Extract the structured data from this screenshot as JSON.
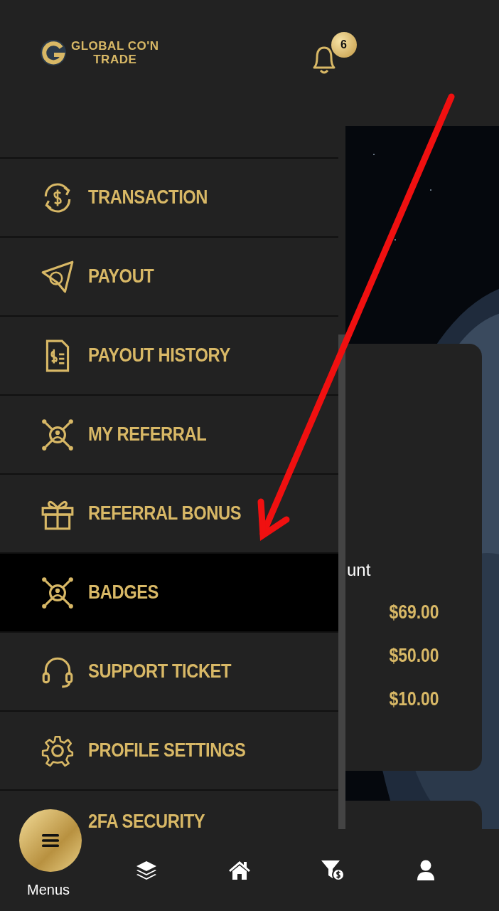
{
  "header": {
    "logo_line_1": "GLOBAL CO'N",
    "logo_line_2": "TRADE",
    "notification_count": "6"
  },
  "menu": [
    {
      "label": "TRANSACTION",
      "kind": "transaction",
      "selected": false
    },
    {
      "label": "PAYOUT",
      "kind": "payout",
      "selected": false
    },
    {
      "label": "PAYOUT HISTORY",
      "kind": "document",
      "selected": false
    },
    {
      "label": "MY REFERRAL",
      "kind": "network",
      "selected": false
    },
    {
      "label": "REFERRAL BONUS",
      "kind": "gift",
      "selected": false
    },
    {
      "label": "BADGES",
      "kind": "network",
      "selected": true
    },
    {
      "label": "SUPPORT TICKET",
      "kind": "headset",
      "selected": false
    },
    {
      "label": "PROFILE SETTINGS",
      "kind": "gear",
      "selected": false
    },
    {
      "label": "2FA SECURITY",
      "kind": "none",
      "selected": false
    }
  ],
  "card": {
    "heading": "unt",
    "amounts": [
      "$69.00",
      "$50.00",
      "$10.00"
    ]
  },
  "bottom_nav": {
    "menu_label": "Menus",
    "items": [
      {
        "kind": "layers"
      },
      {
        "kind": "home"
      },
      {
        "kind": "funnel"
      },
      {
        "kind": "user"
      }
    ]
  }
}
